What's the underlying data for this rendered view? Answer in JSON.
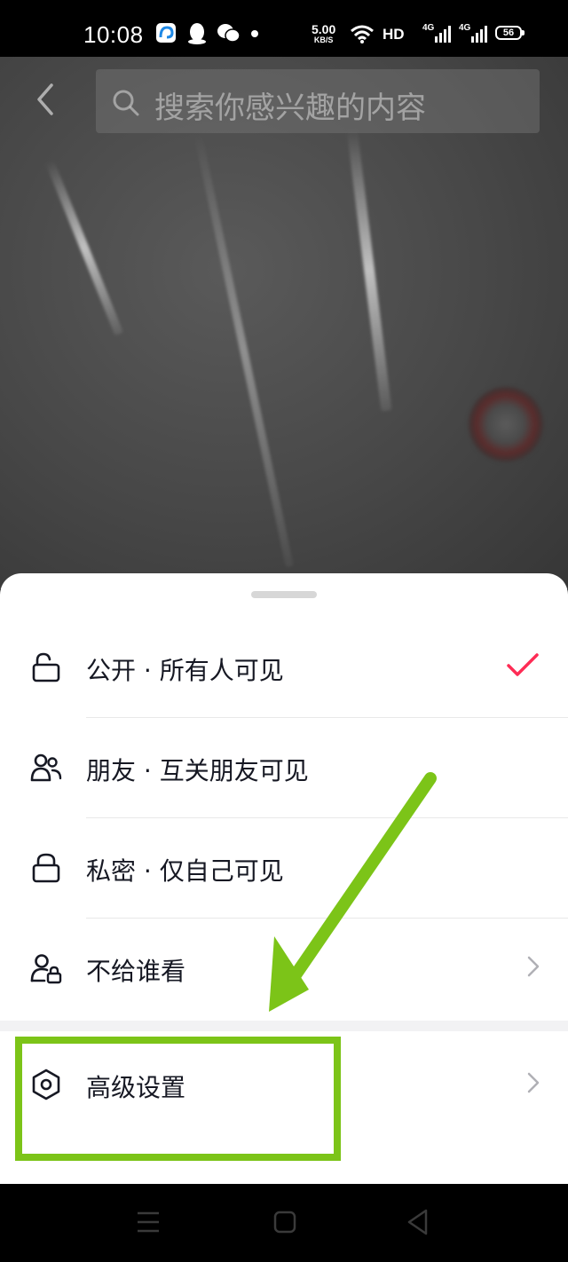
{
  "status_bar": {
    "time": "10:08",
    "net_speed_value": "5.00",
    "net_speed_unit": "KB/S",
    "hd_label": "HD",
    "network_1": "4G",
    "network_2": "4G",
    "battery_level": "56",
    "icons": [
      "browser-icon",
      "qq-icon",
      "wechat-icon",
      "notification-dot-icon",
      "wifi-icon",
      "signal-icon",
      "signal-icon",
      "battery-icon"
    ]
  },
  "search": {
    "placeholder": "搜索你感兴趣的内容"
  },
  "privacy_sheet": {
    "options": [
      {
        "label": "公开 · 所有人可见",
        "icon": "unlock-icon",
        "selected": true,
        "trailing": "check-icon"
      },
      {
        "label": "朋友 · 互关朋友可见",
        "icon": "friends-icon",
        "selected": false,
        "trailing": ""
      },
      {
        "label": "私密 · 仅自己可见",
        "icon": "lock-icon",
        "selected": false,
        "trailing": ""
      },
      {
        "label": "不给谁看",
        "icon": "user-lock-icon",
        "selected": false,
        "trailing": "chevron-right-icon"
      }
    ],
    "advanced": {
      "label": "高级设置",
      "icon": "hexagon-settings-icon",
      "trailing": "chevron-right-icon"
    }
  },
  "colors": {
    "check": "#FE2C55",
    "annotation_green": "#7CC418",
    "label_text": "#161823"
  },
  "nav_bar": {
    "icons": [
      "menu-icon",
      "home-square-icon",
      "back-triangle-icon"
    ]
  }
}
